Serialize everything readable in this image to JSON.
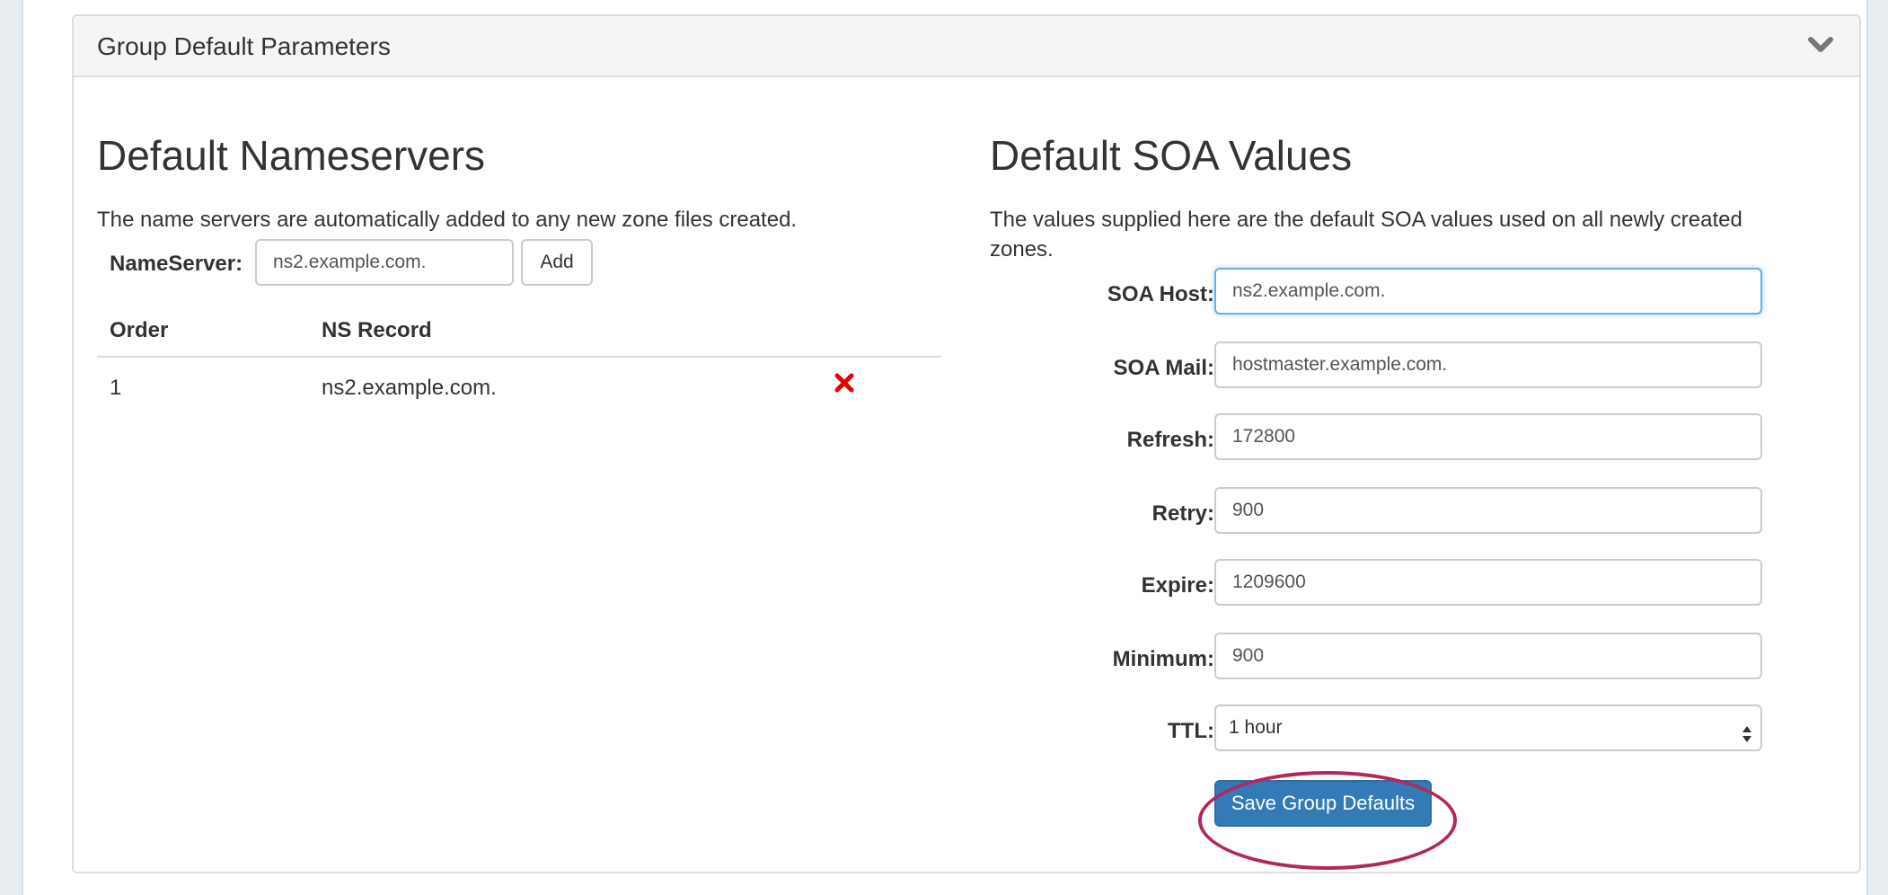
{
  "panel": {
    "title": "Group Default Parameters",
    "toggle_icon": "chevron-down-icon"
  },
  "nameservers": {
    "heading": "Default Nameservers",
    "description": "The name servers are automatically added to any new zone files created.",
    "input_label": "NameServer:",
    "input_value": "ns2.example.com.",
    "add_label": "Add",
    "table": {
      "headers": [
        "Order",
        "NS Record"
      ],
      "rows": [
        {
          "order": "1",
          "record": "ns2.example.com.",
          "delete_icon": "close-icon",
          "delete_color": "#e60000"
        }
      ]
    }
  },
  "soa": {
    "heading": "Default SOA Values",
    "description": "The values supplied here are the default SOA values used on all newly created zones.",
    "fields": [
      {
        "label": "SOA Host:",
        "value": "ns2.example.com."
      },
      {
        "label": "SOA Mail:",
        "value": "hostmaster.example.com."
      },
      {
        "label": "Refresh:",
        "value": "172800"
      },
      {
        "label": "Retry:",
        "value": "900"
      },
      {
        "label": "Expire:",
        "value": "1209600"
      },
      {
        "label": "Minimum:",
        "value": "900"
      }
    ],
    "ttl_label": "TTL:",
    "ttl_value": "1 hour",
    "save_label": "Save Group Defaults"
  },
  "colors": {
    "primary": "#337ab7",
    "highlight": "#b3285a"
  }
}
